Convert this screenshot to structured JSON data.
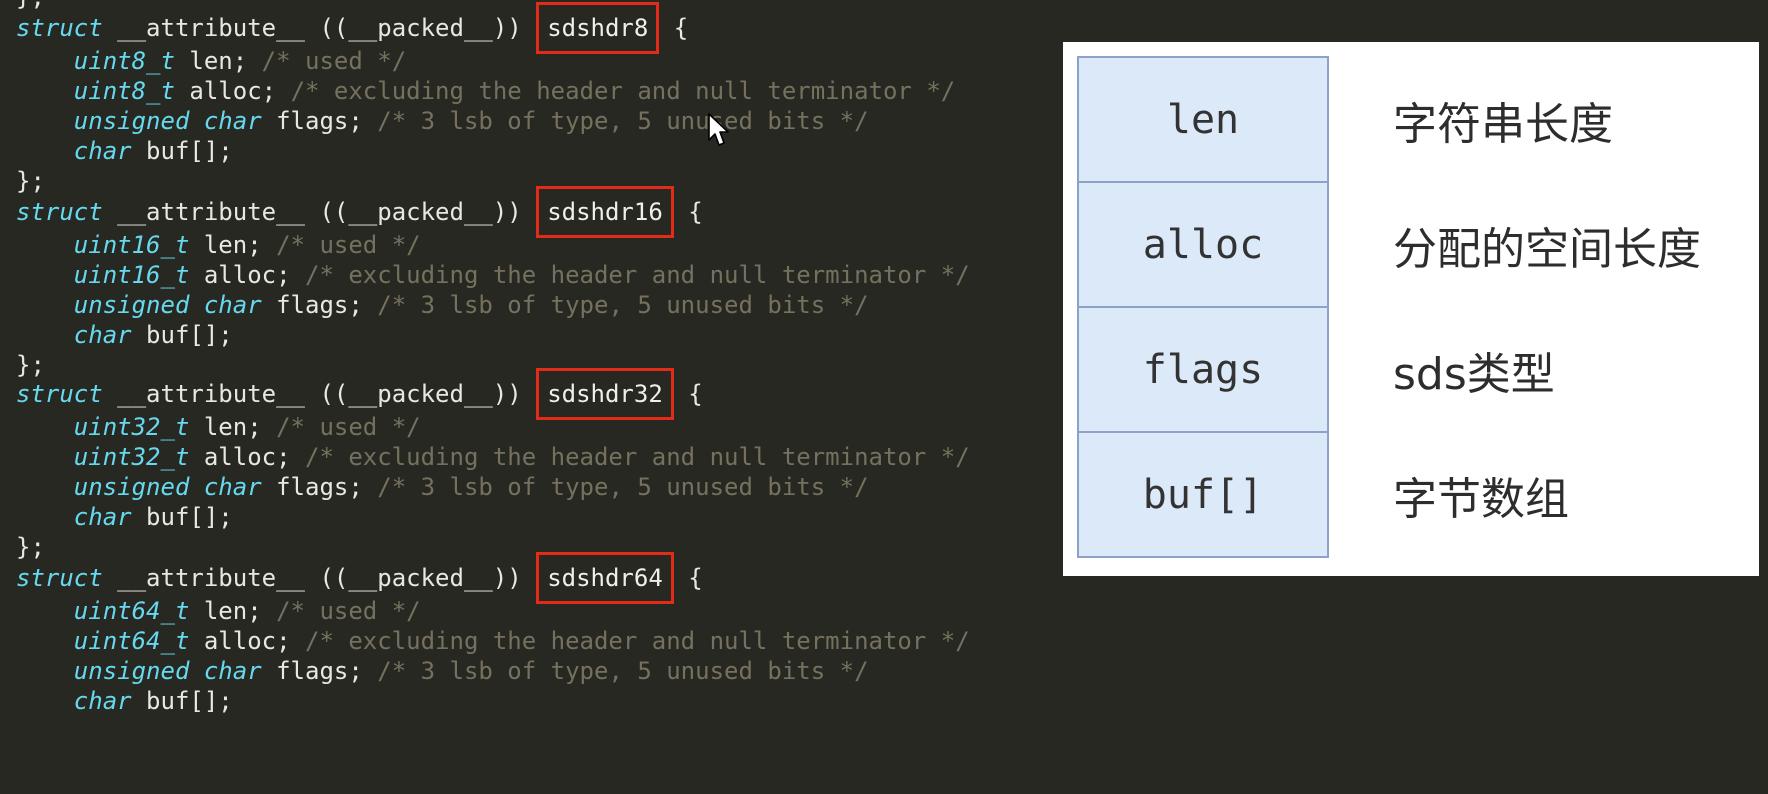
{
  "code": {
    "top_fragment": "};",
    "keywords": {
      "struct": "struct",
      "unsigned": "unsigned",
      "char": "char"
    },
    "attribute": "__attribute__ ((__packed__))",
    "open_brace": "{",
    "close_brace": "};",
    "structs": [
      {
        "name": "sdshdr8",
        "int_type": "uint8_t",
        "len_decl": "len;",
        "len_comment": "/* used */",
        "alloc_decl": "alloc;",
        "alloc_comment": "/* excluding the header and null terminator */",
        "flags_decl": "flags;",
        "flags_comment": "/* 3 lsb of type, 5 unused bits */",
        "buf_decl": "buf[];"
      },
      {
        "name": "sdshdr16",
        "int_type": "uint16_t",
        "len_decl": "len;",
        "len_comment": "/* used */",
        "alloc_decl": "alloc;",
        "alloc_comment": "/* excluding the header and null terminator */",
        "flags_decl": "flags;",
        "flags_comment": "/* 3 lsb of type, 5 unused bits */",
        "buf_decl": "buf[];"
      },
      {
        "name": "sdshdr32",
        "int_type": "uint32_t",
        "len_decl": "len;",
        "len_comment": "/* used */",
        "alloc_decl": "alloc;",
        "alloc_comment": "/* excluding the header and null terminator */",
        "flags_decl": "flags;",
        "flags_comment": "/* 3 lsb of type, 5 unused bits */",
        "buf_decl": "buf[];"
      },
      {
        "name": "sdshdr64",
        "int_type": "uint64_t",
        "len_decl": "len;",
        "len_comment": "/* used */",
        "alloc_decl": "alloc;",
        "alloc_comment": "/* excluding the header and null terminator */",
        "flags_decl": "flags;",
        "flags_comment": "/* 3 lsb of type, 5 unused bits */",
        "buf_decl": "buf[];"
      }
    ]
  },
  "diagram": {
    "fields": [
      {
        "field": "len",
        "desc": "字符串长度"
      },
      {
        "field": "alloc",
        "desc": "分配的空间长度"
      },
      {
        "field": "flags",
        "desc": "sds类型"
      },
      {
        "field": "buf[]",
        "desc": "字节数组"
      }
    ]
  },
  "colors": {
    "editor_background": "#272822",
    "keyword": "#66d9ef",
    "comment": "#75715e",
    "highlight_box": "#e22b18",
    "cell_fill": "#dce9f9",
    "cell_border": "#8ca2c8"
  },
  "icons": {
    "cursor": "mouse-pointer-icon"
  }
}
